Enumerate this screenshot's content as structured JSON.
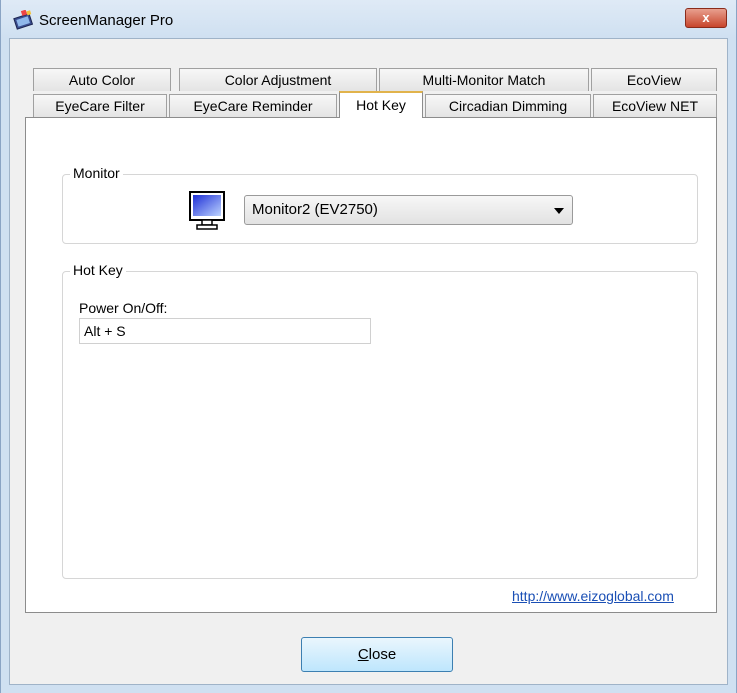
{
  "window": {
    "title": "ScreenManager Pro",
    "close_glyph": "x"
  },
  "tabs": {
    "row1": [
      "Auto Color",
      "Color Adjustment",
      "Multi-Monitor Match",
      "EcoView"
    ],
    "row2": [
      "EyeCare Filter",
      "EyeCare Reminder",
      "Hot Key",
      "Circadian Dimming",
      "EcoView NET"
    ],
    "active": "Hot Key"
  },
  "monitor_group": {
    "label": "Monitor",
    "selected_monitor": "Monitor2 (EV2750)",
    "icon": "monitor-icon"
  },
  "hotkey_group": {
    "label": "Hot Key",
    "power_label": "Power On/Off:",
    "power_value": "Alt + S"
  },
  "footer": {
    "link_text": "http://www.eizoglobal.com",
    "close_accel": "C",
    "close_rest": "lose"
  },
  "colors": {
    "accent_tab_top": "#e1b34b",
    "link": "#1a4fb5",
    "button_border": "#3c7fb1"
  }
}
